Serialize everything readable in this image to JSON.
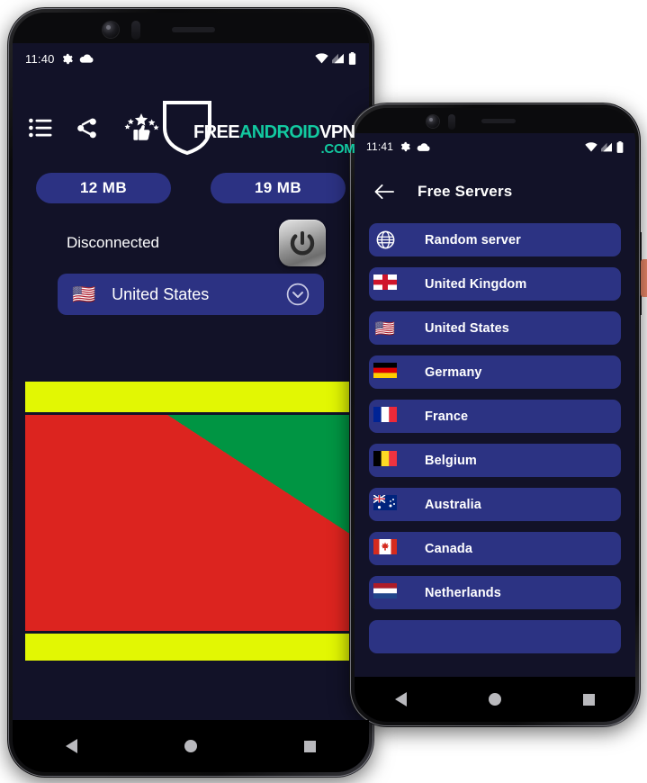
{
  "page": {
    "background": "#ffffff",
    "app_screen_bg": "#121228",
    "accent_blue": "#2c3283",
    "logo_teal": "#12c9a0"
  },
  "phone_front": {
    "status_bar": {
      "time": "11:40",
      "left_icons": [
        "gear-icon",
        "cloud-icon"
      ],
      "right_icons": [
        "wifi-icon",
        "signal-icon",
        "battery-icon"
      ]
    },
    "toolbar": {
      "icons": [
        {
          "name": "list-icon",
          "label": "Servers list"
        },
        {
          "name": "share-icon",
          "label": "Share"
        },
        {
          "name": "rate-stars-icon",
          "label": "Rate us"
        }
      ]
    },
    "logo": {
      "part1": "FREE",
      "part2": "ANDROID",
      "part3": "VPN",
      "part4": ".COM",
      "shield": "shield-icon"
    },
    "usage": {
      "download": "12 MB",
      "upload": "19 MB"
    },
    "connection": {
      "status": "Disconnected",
      "power_button": "power-icon"
    },
    "selected_server": {
      "flag": "🇺🇸",
      "name": "United States",
      "chevron": "chevron-down-circle-icon"
    },
    "banner": {
      "type": "flag-image",
      "country": "Republic of the Congo",
      "colors": {
        "top_bar": "#e2f703",
        "green": "#009543",
        "yellow": "#fbde4a",
        "red": "#dc241f",
        "bottom_bar": "#e2f703"
      }
    },
    "nav_bar": [
      "back-triangle-icon",
      "home-circle-icon",
      "recents-square-icon"
    ]
  },
  "phone_back": {
    "status_bar": {
      "time": "11:41",
      "left_icons": [
        "gear-icon",
        "cloud-icon"
      ],
      "right_icons": [
        "wifi-icon",
        "signal-icon",
        "battery-icon"
      ]
    },
    "app_bar": {
      "back": "arrow-left-icon",
      "title": "Free Servers"
    },
    "servers": [
      {
        "flag": "globe-icon",
        "name": "Random server",
        "is_globe": true
      },
      {
        "flag": "🏴󠁧󠁢󠁥󠁮󠁧󠁿",
        "name": "United Kingdom",
        "is_globe": false
      },
      {
        "flag": "🇺🇸",
        "name": "United States",
        "is_globe": false
      },
      {
        "flag": "🇩🇪",
        "name": "Germany",
        "is_globe": false
      },
      {
        "flag": "🇫🇷",
        "name": "France",
        "is_globe": false
      },
      {
        "flag": "🇧🇪",
        "name": "Belgium",
        "is_globe": false
      },
      {
        "flag": "🇦🇺",
        "name": "Australia",
        "is_globe": false
      },
      {
        "flag": "🇨🇦",
        "name": "Canada",
        "is_globe": false
      },
      {
        "flag": "🇳🇱",
        "name": "Netherlands",
        "is_globe": false
      },
      {
        "flag": "",
        "name": "",
        "is_globe": false
      }
    ],
    "nav_bar": [
      "back-triangle-icon",
      "home-circle-icon",
      "recents-square-icon"
    ]
  }
}
